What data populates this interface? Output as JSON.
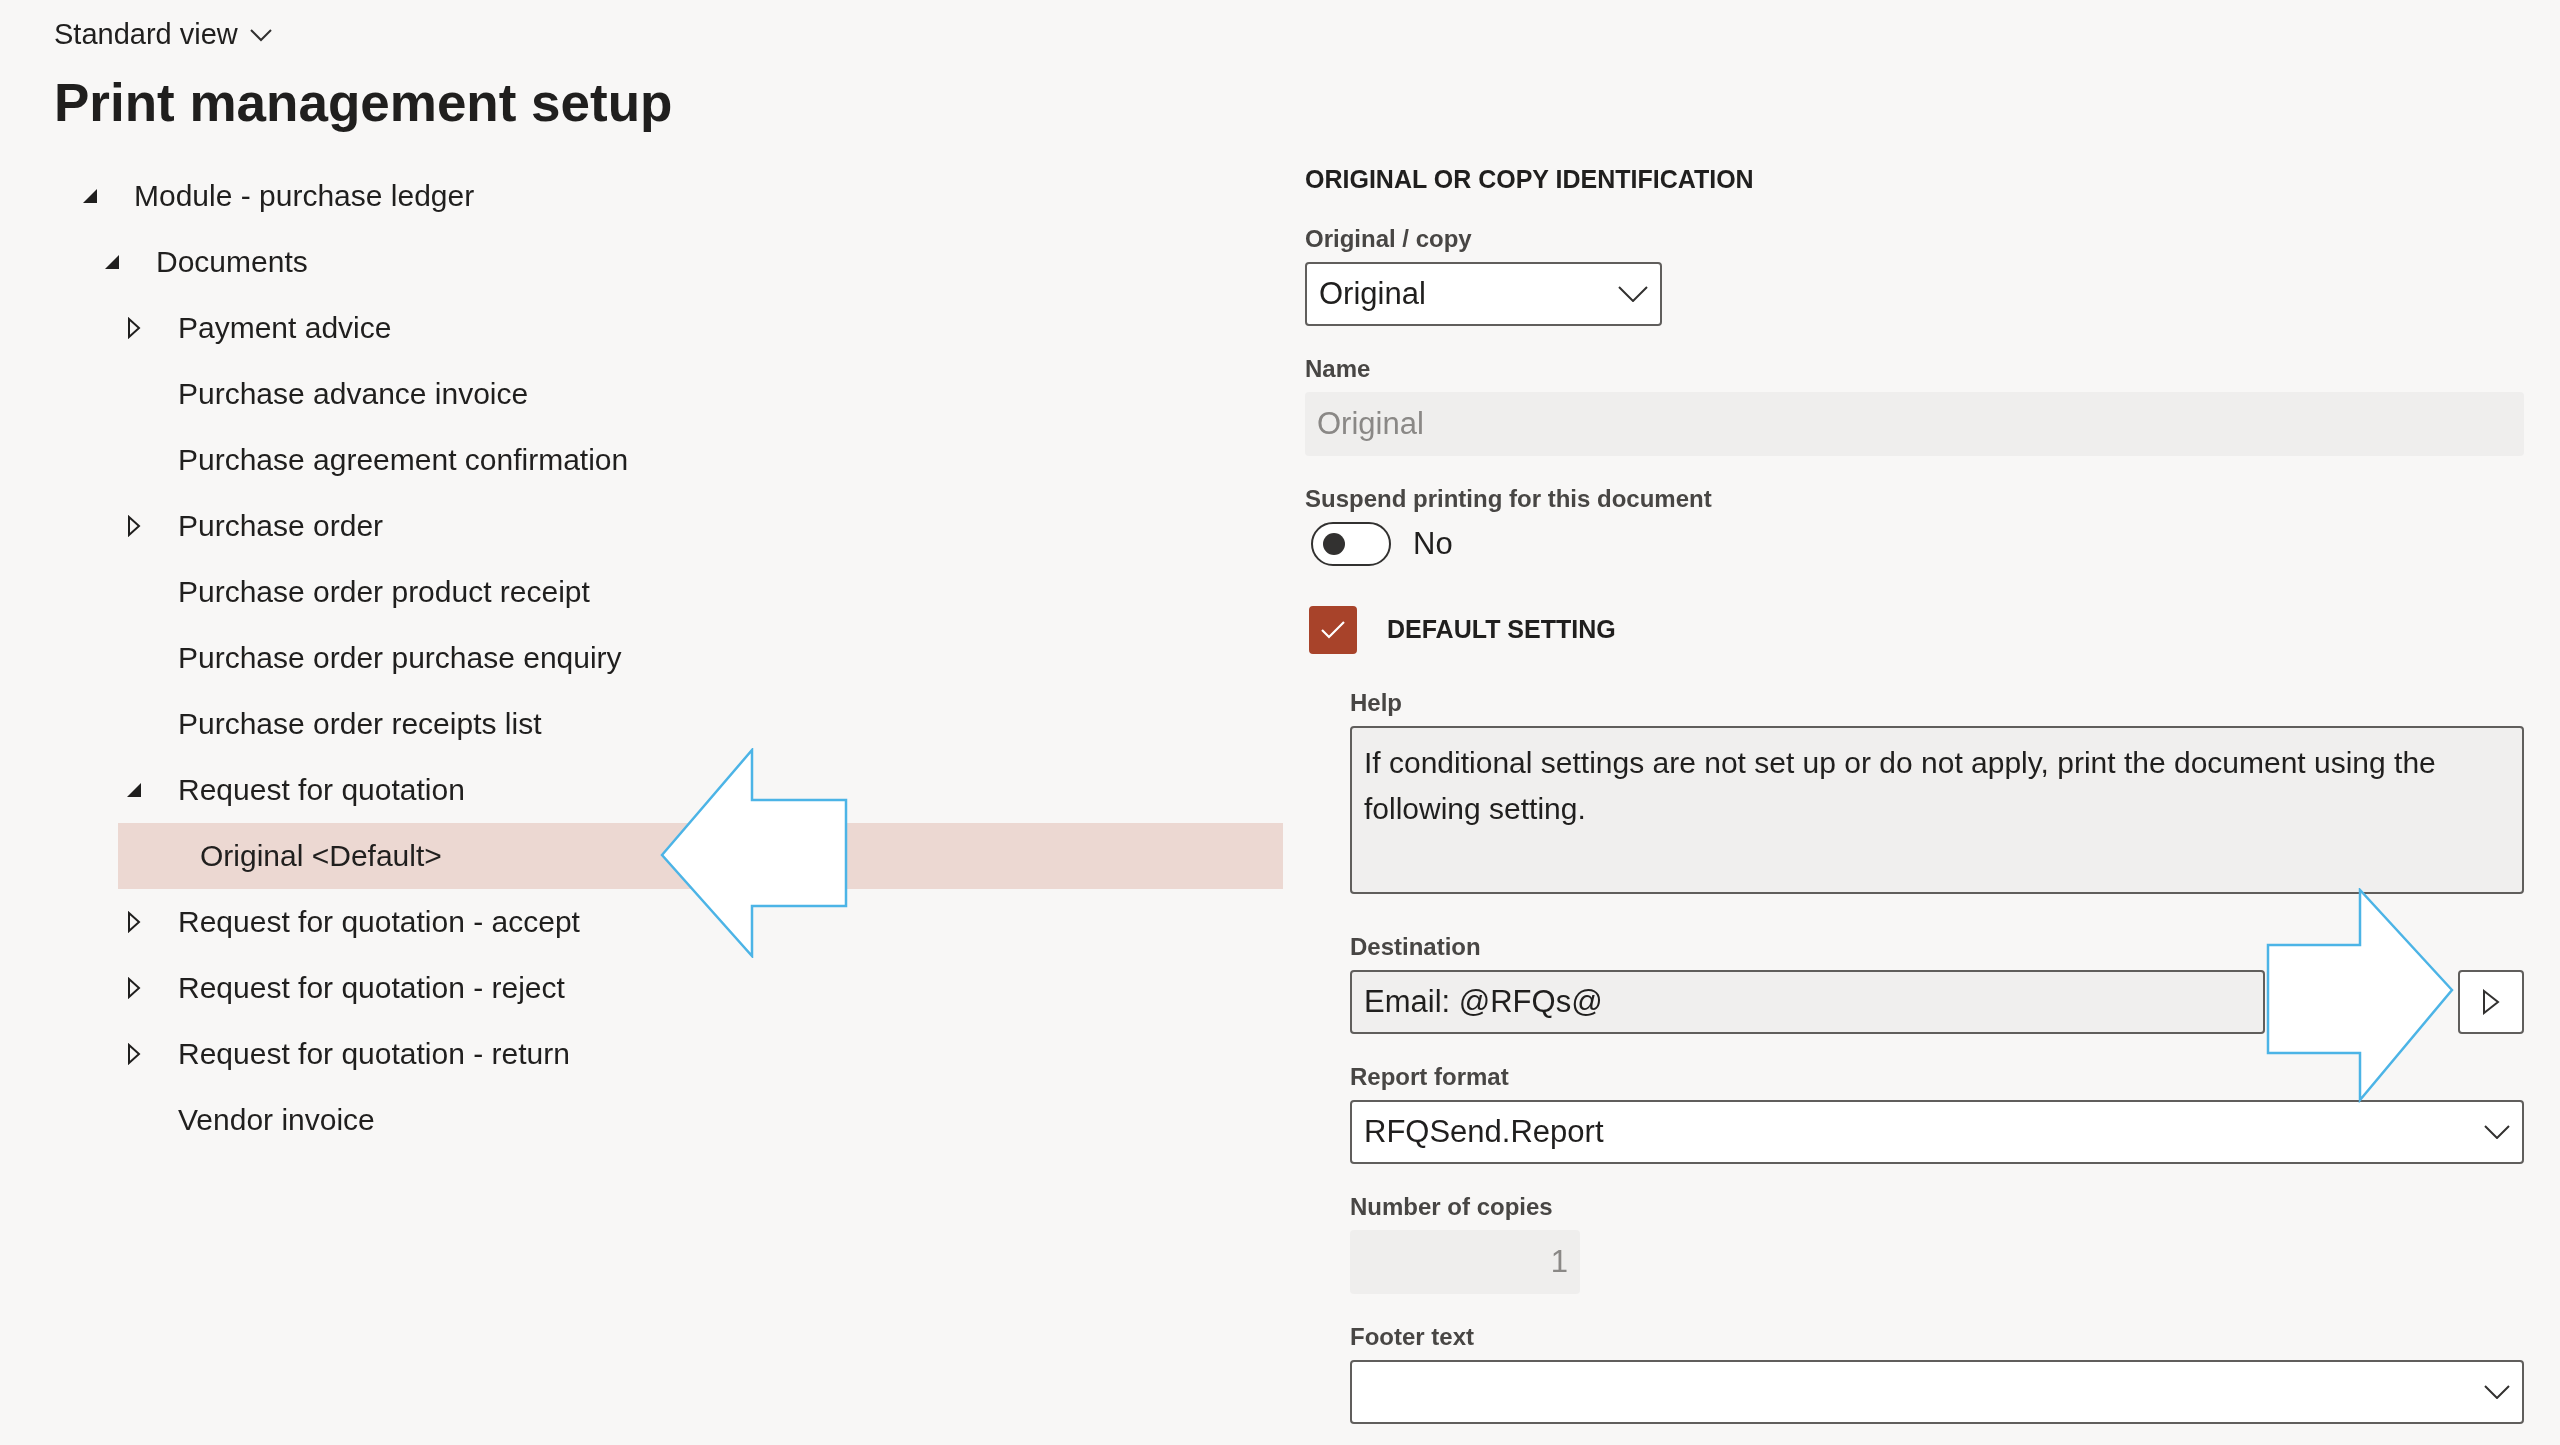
{
  "header": {
    "view_selector": "Standard view",
    "title": "Print management setup"
  },
  "tree": [
    {
      "label": "Module - purchase ledger",
      "kind": "branch",
      "expanded": true,
      "selected": false,
      "children": [
        {
          "label": "Documents",
          "kind": "branch",
          "expanded": true,
          "selected": false,
          "children": [
            {
              "label": "Payment advice",
              "kind": "branch",
              "expanded": false,
              "selected": false
            },
            {
              "label": "Purchase advance invoice",
              "kind": "leaf",
              "selected": false
            },
            {
              "label": "Purchase agreement confirmation",
              "kind": "leaf",
              "selected": false
            },
            {
              "label": "Purchase order",
              "kind": "branch",
              "expanded": false,
              "selected": false
            },
            {
              "label": "Purchase order product receipt",
              "kind": "leaf",
              "selected": false
            },
            {
              "label": "Purchase order purchase enquiry",
              "kind": "leaf",
              "selected": false
            },
            {
              "label": "Purchase order receipts list",
              "kind": "leaf",
              "selected": false
            },
            {
              "label": "Request for quotation",
              "kind": "branch",
              "expanded": true,
              "selected": false,
              "children": [
                {
                  "label": "Original <Default>",
                  "kind": "leaf",
                  "selected": true
                }
              ]
            },
            {
              "label": "Request for quotation - accept",
              "kind": "branch",
              "expanded": false,
              "selected": false
            },
            {
              "label": "Request for quotation - reject",
              "kind": "branch",
              "expanded": false,
              "selected": false
            },
            {
              "label": "Request for quotation - return",
              "kind": "branch",
              "expanded": false,
              "selected": false
            },
            {
              "label": "Vendor invoice",
              "kind": "leaf",
              "selected": false
            }
          ]
        }
      ]
    }
  ],
  "form": {
    "section_title": "ORIGINAL OR COPY IDENTIFICATION",
    "original_copy": {
      "label": "Original / copy",
      "value": "Original"
    },
    "name": {
      "label": "Name",
      "value": "Original",
      "disabled": true
    },
    "suspend_printing": {
      "label": "Suspend printing for this document",
      "on": false,
      "value_text": "No"
    },
    "default_setting": {
      "title": "DEFAULT SETTING",
      "checked": true
    },
    "help": {
      "label": "Help",
      "text": "If conditional settings are not set up or do not apply, print the document using the following setting."
    },
    "destination": {
      "label": "Destination",
      "value": "Email: @RFQs@"
    },
    "report_format": {
      "label": "Report format",
      "value": "RFQSend.Report"
    },
    "copies": {
      "label": "Number of copies",
      "value": "1"
    },
    "footer_text": {
      "label": "Footer text"
    }
  }
}
